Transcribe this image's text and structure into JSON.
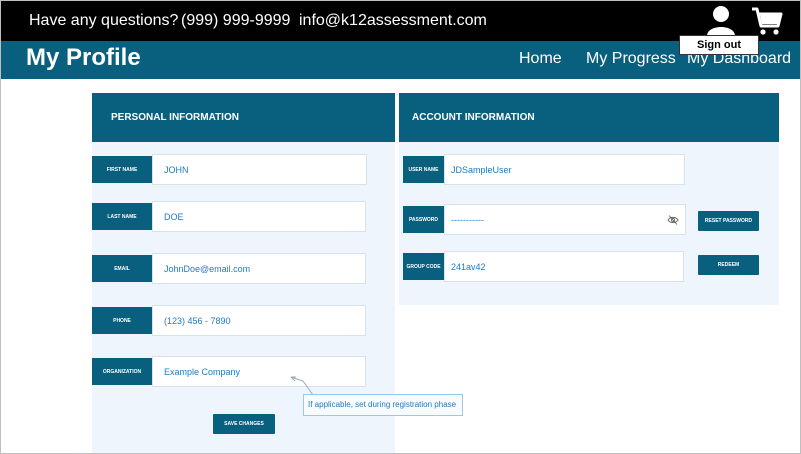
{
  "topbar": {
    "question": "Have any questions?",
    "phone": "(999) 999-9999",
    "email": "info@k12assessment.com",
    "signout_label": "Sign out",
    "icons": [
      "user-icon",
      "shopping-cart-icon"
    ]
  },
  "navbar": {
    "title": "My Profile",
    "links": [
      "Home",
      "My Progress",
      "My Dashboard"
    ]
  },
  "personal": {
    "header": "PERSONAL INFORMATION",
    "fields": [
      {
        "label": "FIRST NAME",
        "value": "JOHN"
      },
      {
        "label": "LAST NAME",
        "value": "DOE"
      },
      {
        "label": "EMAIL",
        "value": "JohnDoe@email.com"
      },
      {
        "label": "PHONE",
        "value": "(123) 456 - 7890"
      },
      {
        "label": "ORGANIZATION",
        "value": "Example Company"
      }
    ],
    "save_label": "SAVE CHANGES",
    "tooltip": "If applicable, set during registration phase"
  },
  "account": {
    "header": "ACCOUNT INFORMATION",
    "fields": [
      {
        "label": "USER NAME",
        "value": "JDSampleUser"
      },
      {
        "label": "PASSWORD",
        "value": "-----------"
      },
      {
        "label": "GROUP CODE",
        "value": "241av42"
      }
    ],
    "reset_label": "RESET PASSWORD",
    "redeem_label": "REDEEM",
    "password_icon": "eye-slash-icon"
  },
  "colors": {
    "brand": "#085f7e",
    "topbar": "#000000",
    "panel_bg": "#eef5fd",
    "value_text": "#1f7bc0"
  }
}
